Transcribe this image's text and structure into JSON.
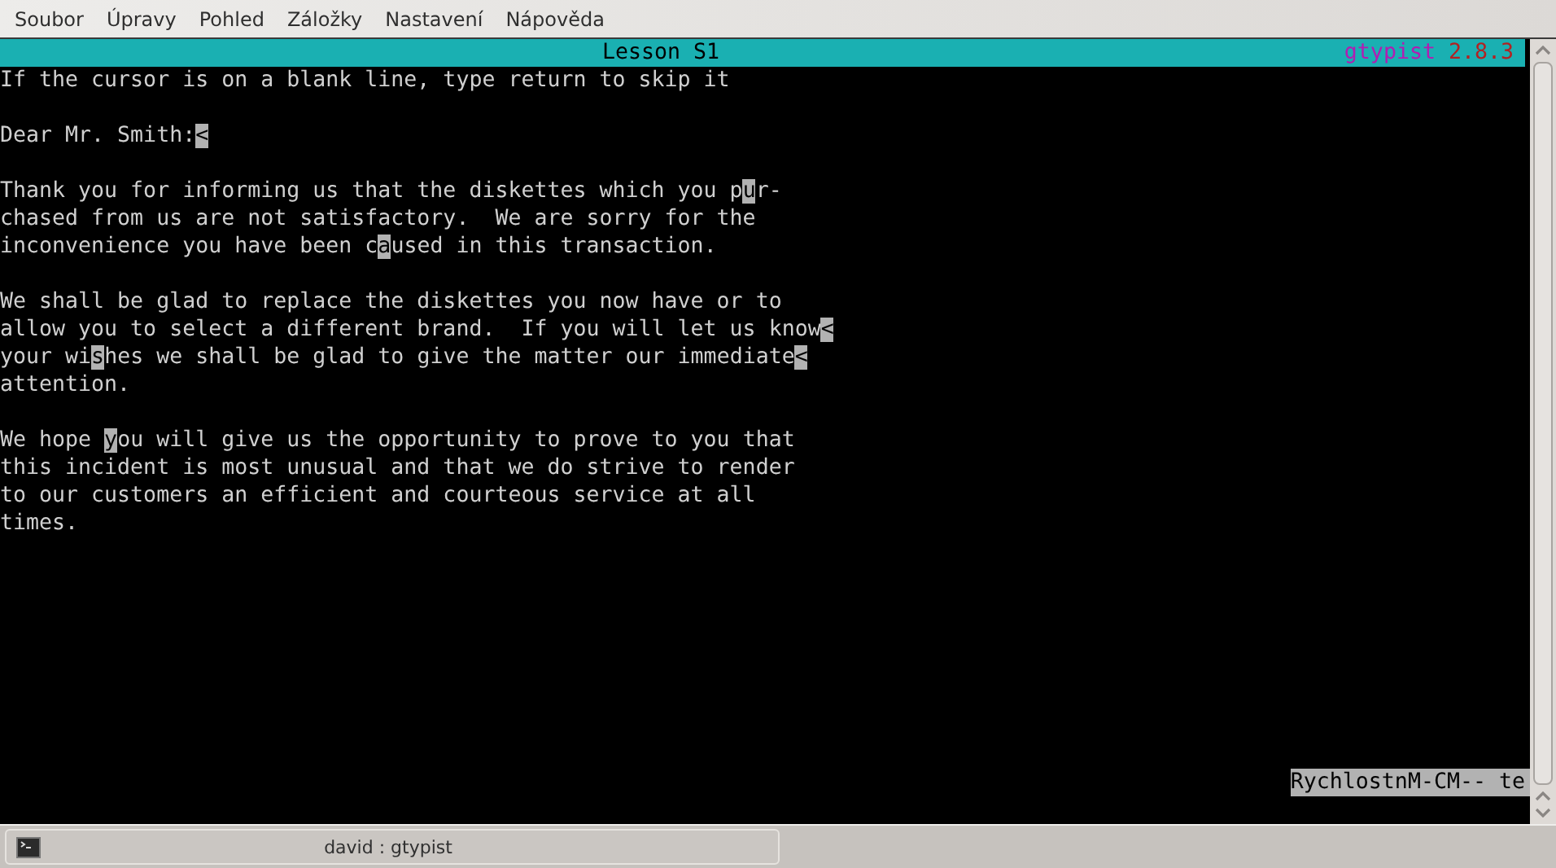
{
  "menu": [
    "Soubor",
    "Úpravy",
    "Pohled",
    "Záložky",
    "Nastavení",
    "Nápověda"
  ],
  "terminal": {
    "header": {
      "title": "Lesson S1",
      "app_name": "gtypist",
      "version": "2.8.3"
    },
    "lines": [
      {
        "kind": "text",
        "segments": [
          {
            "text": "If the cursor is on a blank line, type return to skip it",
            "inverse": false
          }
        ]
      },
      {
        "kind": "blank"
      },
      {
        "kind": "text",
        "segments": [
          {
            "text": "Dear Mr. Smith:",
            "inverse": false
          },
          {
            "text": "<",
            "inverse": true
          }
        ]
      },
      {
        "kind": "blank"
      },
      {
        "kind": "text",
        "segments": [
          {
            "text": "Thank you for informing us that the diskettes which you p",
            "inverse": false
          },
          {
            "text": "u",
            "inverse": true
          },
          {
            "text": "r-",
            "inverse": false
          }
        ]
      },
      {
        "kind": "text",
        "segments": [
          {
            "text": "chased from us are not satisfactory.  We are sorry for the",
            "inverse": false
          }
        ]
      },
      {
        "kind": "text",
        "segments": [
          {
            "text": "inconvenience you have been c",
            "inverse": false
          },
          {
            "text": "a",
            "inverse": true
          },
          {
            "text": "used in this transaction.",
            "inverse": false
          }
        ]
      },
      {
        "kind": "blank"
      },
      {
        "kind": "text",
        "segments": [
          {
            "text": "We shall be glad to replace the diskettes you now have or to",
            "inverse": false
          }
        ]
      },
      {
        "kind": "text",
        "segments": [
          {
            "text": "allow you to select a different brand.  If you will let us know",
            "inverse": false
          },
          {
            "text": "<",
            "inverse": true
          }
        ]
      },
      {
        "kind": "text",
        "segments": [
          {
            "text": "your wi",
            "inverse": false
          },
          {
            "text": "s",
            "inverse": true
          },
          {
            "text": "hes we shall be glad to give the matter our immediate",
            "inverse": false
          },
          {
            "text": "<",
            "inverse": true
          }
        ]
      },
      {
        "kind": "text",
        "segments": [
          {
            "text": "attention.",
            "inverse": false
          }
        ]
      },
      {
        "kind": "blank"
      },
      {
        "kind": "text",
        "segments": [
          {
            "text": "We hope ",
            "inverse": false
          },
          {
            "text": "y",
            "inverse": true
          },
          {
            "text": "ou will give us the opportunity to prove to you that",
            "inverse": false
          }
        ]
      },
      {
        "kind": "text",
        "segments": [
          {
            "text": "this incident is most unusual and that we do strive to render",
            "inverse": false
          }
        ]
      },
      {
        "kind": "text",
        "segments": [
          {
            "text": "to our customers an efficient and courteous service at all",
            "inverse": false
          }
        ]
      },
      {
        "kind": "text",
        "segments": [
          {
            "text": "times.",
            "inverse": false
          }
        ]
      }
    ],
    "status": "RychlostnM-CM-- te"
  },
  "taskbar": {
    "tasks": [
      {
        "label": "david : gtypist"
      }
    ]
  }
}
